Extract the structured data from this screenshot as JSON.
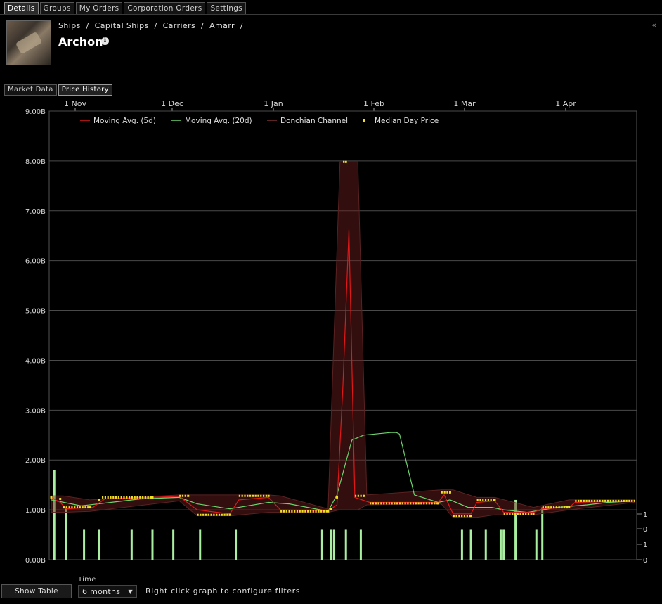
{
  "tabs": [
    "Details",
    "Groups",
    "My Orders",
    "Corporation Orders",
    "Settings"
  ],
  "breadcrumb": [
    "Ships",
    "/",
    "Capital Ships",
    "/",
    "Carriers",
    "/",
    "Amarr",
    "/"
  ],
  "item": {
    "name": "Archon",
    "info_icon": "info-icon"
  },
  "subtabs": [
    "Market Data",
    "Price History"
  ],
  "chart_data": {
    "type": "line",
    "x_axis_ticks": [
      "1 Nov",
      "1 Dec",
      "1 Jan",
      "1 Feb",
      "1 Mar",
      "1 Apr"
    ],
    "y_axis_ticks": [
      "0.00B",
      "1.00B",
      "2.00B",
      "3.00B",
      "4.00B",
      "5.00B",
      "6.00B",
      "7.00B",
      "8.00B",
      "9.00B"
    ],
    "ylim": [
      0,
      9
    ],
    "volume_axis_ticks": [
      "0",
      "1",
      "0",
      "1"
    ],
    "legend": [
      "Moving Avg. (5d)",
      "Moving Avg. (20d)",
      "Donchian Channel",
      "Median Day Price"
    ],
    "colors": {
      "ma5": "#e01818",
      "ma20": "#6cd46c",
      "donchian": "#5a2222",
      "median": "#f0e020",
      "volume": "#a8f0a0"
    },
    "series": [
      {
        "name": "Median Day Price",
        "points": [
          [
            0,
            1.25
          ],
          [
            3,
            1.22
          ],
          [
            4,
            1.05
          ],
          [
            13,
            1.05
          ],
          [
            16,
            1.2
          ],
          [
            17,
            1.25
          ],
          [
            34,
            1.25
          ],
          [
            43,
            1.28
          ],
          [
            46,
            1.28
          ],
          [
            49,
            0.9
          ],
          [
            60,
            0.9
          ],
          [
            63,
            1.28
          ],
          [
            73,
            1.28
          ],
          [
            77,
            0.97
          ],
          [
            93,
            0.97
          ],
          [
            94,
            1.02
          ],
          [
            96,
            1.25
          ],
          [
            98,
            7.98
          ],
          [
            99,
            7.98
          ],
          [
            102,
            1.28
          ],
          [
            105,
            1.28
          ],
          [
            107,
            1.13
          ],
          [
            130,
            1.13
          ],
          [
            131,
            1.35
          ],
          [
            134,
            1.35
          ],
          [
            135,
            0.88
          ],
          [
            141,
            0.88
          ],
          [
            143,
            1.2
          ],
          [
            149,
            1.2
          ],
          [
            152,
            0.92
          ],
          [
            162,
            0.92
          ],
          [
            165,
            1.05
          ],
          [
            174,
            1.05
          ],
          [
            176,
            1.18
          ],
          [
            196,
            1.18
          ]
        ]
      },
      {
        "name": "Moving Avg. (5d)",
        "points": [
          [
            0,
            1.25
          ],
          [
            3,
            1.15
          ],
          [
            5,
            1.02
          ],
          [
            14,
            1.05
          ],
          [
            18,
            1.22
          ],
          [
            34,
            1.25
          ],
          [
            43,
            1.27
          ],
          [
            49,
            1.0
          ],
          [
            60,
            0.92
          ],
          [
            63,
            1.2
          ],
          [
            73,
            1.25
          ],
          [
            77,
            1.0
          ],
          [
            93,
            0.98
          ],
          [
            96,
            1.1
          ],
          [
            98,
            3.5
          ],
          [
            100,
            6.62
          ],
          [
            102,
            1.25
          ],
          [
            107,
            1.15
          ],
          [
            130,
            1.15
          ],
          [
            132,
            1.3
          ],
          [
            135,
            0.92
          ],
          [
            141,
            0.92
          ],
          [
            143,
            1.15
          ],
          [
            149,
            1.18
          ],
          [
            152,
            0.95
          ],
          [
            162,
            0.95
          ],
          [
            165,
            1.02
          ],
          [
            174,
            1.05
          ],
          [
            176,
            1.15
          ],
          [
            196,
            1.18
          ]
        ]
      },
      {
        "name": "Moving Avg. (20d)",
        "points": [
          [
            0,
            1.2
          ],
          [
            10,
            1.08
          ],
          [
            20,
            1.15
          ],
          [
            30,
            1.22
          ],
          [
            43,
            1.25
          ],
          [
            49,
            1.12
          ],
          [
            60,
            1.02
          ],
          [
            73,
            1.15
          ],
          [
            80,
            1.12
          ],
          [
            93,
            0.97
          ],
          [
            96,
            1.3
          ],
          [
            101,
            2.4
          ],
          [
            105,
            2.5
          ],
          [
            114,
            2.55
          ],
          [
            116,
            2.55
          ],
          [
            117,
            2.52
          ],
          [
            122,
            1.3
          ],
          [
            130,
            1.15
          ],
          [
            134,
            1.2
          ],
          [
            140,
            1.05
          ],
          [
            148,
            1.05
          ],
          [
            152,
            1.0
          ],
          [
            160,
            0.95
          ],
          [
            170,
            1.05
          ],
          [
            180,
            1.1
          ],
          [
            187,
            1.15
          ],
          [
            196,
            1.18
          ]
        ]
      }
    ],
    "donchian": [
      [
        0,
        1.28,
        0.95
      ],
      [
        4,
        1.28,
        0.95
      ],
      [
        13,
        1.2,
        0.97
      ],
      [
        43,
        1.3,
        1.18
      ],
      [
        49,
        1.3,
        0.88
      ],
      [
        60,
        1.3,
        0.88
      ],
      [
        73,
        1.3,
        0.95
      ],
      [
        77,
        1.28,
        0.95
      ],
      [
        93,
        1.02,
        0.95
      ],
      [
        97,
        7.98,
        1.0
      ],
      [
        103,
        7.98,
        1.0
      ],
      [
        106,
        1.3,
        1.1
      ],
      [
        131,
        1.4,
        1.12
      ],
      [
        135,
        1.4,
        0.85
      ],
      [
        143,
        1.25,
        0.85
      ],
      [
        149,
        1.25,
        0.9
      ],
      [
        162,
        1.05,
        0.9
      ],
      [
        174,
        1.2,
        1.0
      ],
      [
        196,
        1.2,
        1.15
      ]
    ],
    "volume_bars": [
      [
        1,
        1.8
      ],
      [
        5,
        1.05
      ],
      [
        11,
        0.6
      ],
      [
        16,
        0.6
      ],
      [
        27,
        0.6
      ],
      [
        34,
        0.6
      ],
      [
        41,
        0.6
      ],
      [
        50,
        0.6
      ],
      [
        62,
        0.6
      ],
      [
        91,
        0.6
      ],
      [
        94,
        0.6
      ],
      [
        95,
        0.6
      ],
      [
        99,
        0.6
      ],
      [
        104,
        0.6
      ],
      [
        138,
        0.6
      ],
      [
        141,
        0.6
      ],
      [
        146,
        0.6
      ],
      [
        151,
        0.6
      ],
      [
        152,
        0.6
      ],
      [
        156,
        1.2
      ],
      [
        163,
        0.6
      ],
      [
        165,
        1.05
      ]
    ]
  },
  "footer": {
    "show_table": "Show Table",
    "time_label": "Time",
    "time_value": "6 months",
    "hint": "Right click graph to configure filters"
  }
}
